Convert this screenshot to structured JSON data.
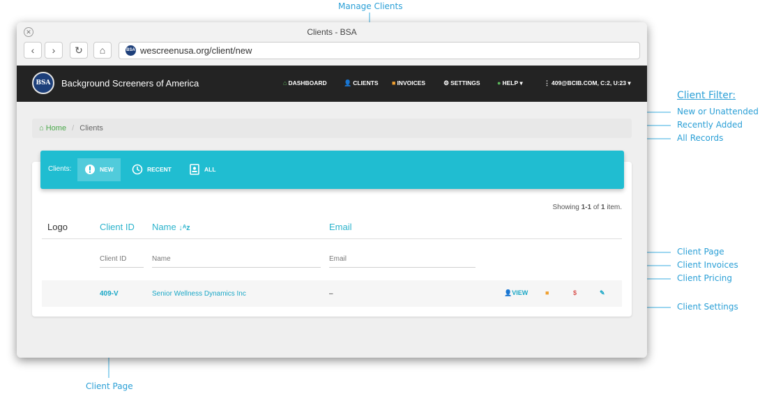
{
  "annotations": {
    "manage_clients": "Manage Clients",
    "client_filter_title": "Client Filter:",
    "new_or_unattended": "New or Unattended",
    "recently_added": "Recently Added",
    "all_records": "All Records",
    "client_page_right": "Client Page",
    "client_invoices": "Client Invoices",
    "client_pricing": "Client Pricing",
    "client_settings": "Client Settings",
    "client_page_bottom": "Client Page"
  },
  "browser": {
    "window_title": "Clients - BSA",
    "url": "wescreenusa.org/client/new",
    "back": "‹",
    "forward": "›",
    "reload": "↻",
    "home": "⌂",
    "close": "✕"
  },
  "app": {
    "logo_text": "BSA",
    "brand": "Background Screeners of America",
    "nav": {
      "dashboard": "DASHBOARD",
      "clients": "CLIENTS",
      "invoices": "INVOICES",
      "settings": "SETTINGS",
      "help": "HELP",
      "account": "409@BCIB.COM, C:2, U:23"
    }
  },
  "breadcrumb": {
    "home": "Home",
    "separator": "/",
    "current": "Clients"
  },
  "filter": {
    "label": "Clients:",
    "new": "NEW",
    "recent": "RECENT",
    "all": "ALL"
  },
  "summary": {
    "prefix": "Showing ",
    "range": "1-1",
    "of": " of ",
    "total": "1",
    "suffix": " item."
  },
  "table": {
    "headers": {
      "logo": "Logo",
      "client_id": "Client ID",
      "name": "Name",
      "email": "Email"
    },
    "filters": {
      "client_id": "Client ID",
      "name": "Name",
      "email": "Email"
    },
    "rows": [
      {
        "client_id": "409-V",
        "name": "Senior Wellness Dynamics Inc",
        "email": "–",
        "view": "VIEW"
      }
    ]
  },
  "colors": {
    "accent": "#20bdd1",
    "link": "#1aa7c6",
    "annotation": "#2a9fd6",
    "nav_bg": "#232323"
  }
}
